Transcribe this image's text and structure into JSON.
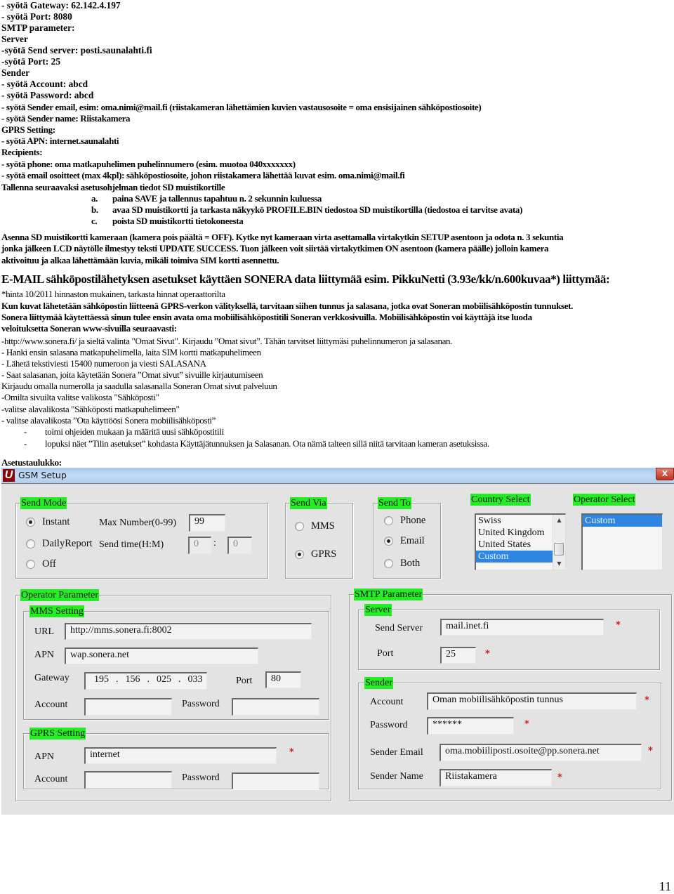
{
  "instructions_top": {
    "lines": [
      "- syötä Gateway: 62.142.4.197",
      "- syötä Port: 8080",
      "SMTP parameter:",
      "Server",
      "-syötä Send server: posti.saunalahti.fi",
      "-syötä Port: 25",
      "Sender",
      "- syötä Account: abcd",
      " - syötä Password: abcd",
      "- syötä Sender email, esim: oma.nimi@mail.fi  (riistakameran lähettämien  kuvien vastausosoite = oma ensisijainen sähköpostiosoite)",
      "- syötä Sender name: Riistakamera",
      "GPRS Setting:",
      "- syötä APN: internet.saunalahti",
      "Recipients:",
      "- syötä phone: oma matkapuhelimen puhelinnumero (esim. muotoa 040xxxxxxx)",
      " - syötä email osoitteet (max 4kpl): sähköpostiosoite, johon riistakamera lähettää kuvat esim. oma.nimi@mail.fi",
      "Tallenna seuraavaksi asetusohjelman tiedot SD muistikortille"
    ],
    "steps": [
      {
        "letter": "a.",
        "text": "paina SAVE ja tallennus tapahtuu n. 2 sekunnin kuluessa"
      },
      {
        "letter": "b.",
        "text": "avaa SD muistikortti ja tarkasta näkyykö PROFILE.BIN tiedostoa SD muistikortilla (tiedostoa ei tarvitse avata)"
      },
      {
        "letter": "c.",
        "text": "poista SD muistikortti tietokoneesta"
      }
    ],
    "install_paragraph": [
      "Asenna SD muistikortti kameraan (kamera pois päältä = OFF). Kytke nyt kameraan virta asettamalla virtakytkin SETUP asentoon ja odota n. 3 sekuntia",
      "jonka jälkeen LCD näytölle ilmestyy teksti UPDATE SUCCESS. Tuon jälkeen voit siirtää virtakytkimen ON asentoon (kamera päälle) jolloin kamera",
      "aktivoituu ja alkaa lähettämään kuvia, mikäli toimiva SIM kortti asennettu."
    ]
  },
  "email_section": {
    "heading": "E-MAIL sähköpostilähetyksen asetukset käyttäen SONERA data liittymää esim. PikkuNetti (3.93e/kk/n.600kuvaa*) liittymää:",
    "price_note": "*hinta 10/2011 hinnaston mukainen, tarkasta hinnat operaattorilta",
    "bold_lines": [
      "Kun kuvat lähetetään sähköpostin liitteenä GPRS-verkon välityksellä, tarvitaan siihen tunnus ja salasana, jotka ovat Soneran mobiilisähköpostin tunnukset.",
      "Sonera liittymää käytettäessä sinun tulee ensin avata oma mobiilisähköpostitili Soneran verkkosivuilla. Mobiilisähköpostin voi käyttäjä itse luoda",
      "veloituksetta Soneran www-sivuilla seuraavasti:"
    ],
    "lines": [
      "-http://www.sonera.fi/  ja sieltä valinta \"Omat Sivut\". Kirjaudu ”Omat sivut”. Tähän tarvitset liittymäsi puhelinnumeron ja salasanan.",
      "- Hanki ensin salasana matkapuhelimella, laita SIM kortti matkapuhelimeen",
      "- Lähetä tekstiviesti 15400 numeroon ja viesti SALASANA",
      "- Saat salasanan, joita käytetään Sonera ”Omat sivut” sivuille kirjautumiseen",
      "Kirjaudu omalla numerolla ja saadulla salasanalla Soneran Omat sivut palveluun",
      "-Omilta sivuilta valitse valikosta \"Sähköposti\"",
      "-valitse alavalikosta \"Sähköposti matkapuhelimeen\"",
      "- valitse alavalikosta ”Ota käyttöösi Sonera mobiilisähköposti”"
    ],
    "dash_items": [
      "toimi ohjeiden mukaan ja määritä uusi sähköpostitili",
      "lopuksi näet ”Tilin asetukset” kohdasta Käyttäjätunnuksen ja Salasanan. Ota nämä talteen sillä niitä tarvitaan kameran asetuksissa."
    ],
    "table_label": "Asetustaulukko:"
  },
  "gsm_window": {
    "title": "GSM Setup",
    "logo_letter": "U",
    "close_label": "X",
    "send_mode": {
      "legend": "Send Mode",
      "options": [
        "Instant",
        "DailyReport",
        "Off"
      ],
      "selected": "Instant",
      "max_number_label": "Max Number(0-99)",
      "max_number_value": "99",
      "send_time_label": "Send time(H:M)",
      "send_time_hour": "0",
      "send_time_separator": ":",
      "send_time_minute": "0"
    },
    "send_via": {
      "legend": "Send Via",
      "options": [
        "MMS",
        "GPRS"
      ],
      "selected": "GPRS"
    },
    "send_to": {
      "legend": "Send To",
      "options": [
        "Phone",
        "Email",
        "Both"
      ],
      "selected": "Email"
    },
    "country_select": {
      "label": "Country Select",
      "items": [
        "Swiss",
        "United Kingdom",
        "United States",
        "Custom"
      ],
      "selected": "Custom"
    },
    "operator_select": {
      "label": "Operator Select",
      "items": [
        "Custom"
      ],
      "selected": "Custom"
    },
    "operator_parameter": {
      "legend": "Operator Parameter",
      "mms_setting": {
        "legend": "MMS Setting",
        "url_label": "URL",
        "url_value": "http://mms.sonera.fi:8002",
        "apn_label": "APN",
        "apn_value": "wap.sonera.net",
        "gateway_label": "Gateway",
        "gateway_octets": [
          "195",
          "156",
          "025",
          "033"
        ],
        "port_label": "Port",
        "port_value": "80",
        "account_label": "Account",
        "account_value": "",
        "password_label": "Password",
        "password_value": ""
      },
      "gprs_setting": {
        "legend": "GPRS Setting",
        "apn_label": "APN",
        "apn_value": "internet",
        "account_label": "Account",
        "account_value": "",
        "password_label": "Password",
        "password_value": ""
      }
    },
    "smtp_parameter": {
      "legend": "SMTP Parameter",
      "server": {
        "legend": "Server",
        "send_server_label": "Send Server",
        "send_server_value": "mail.inet.fi",
        "port_label": "Port",
        "port_value": "25"
      },
      "sender": {
        "legend": "Sender",
        "account_label": "Account",
        "account_value": "Oman mobiilisähköpostin tunnus",
        "password_label": "Password",
        "password_value": "******",
        "sender_email_label": "Sender Email",
        "sender_email_value": "oma.mobiiliposti.osoite@pp.sonera.net",
        "sender_name_label": "Sender Name",
        "sender_name_value": "Riistakamera"
      },
      "required_marker": "*"
    }
  },
  "page_number": "11"
}
